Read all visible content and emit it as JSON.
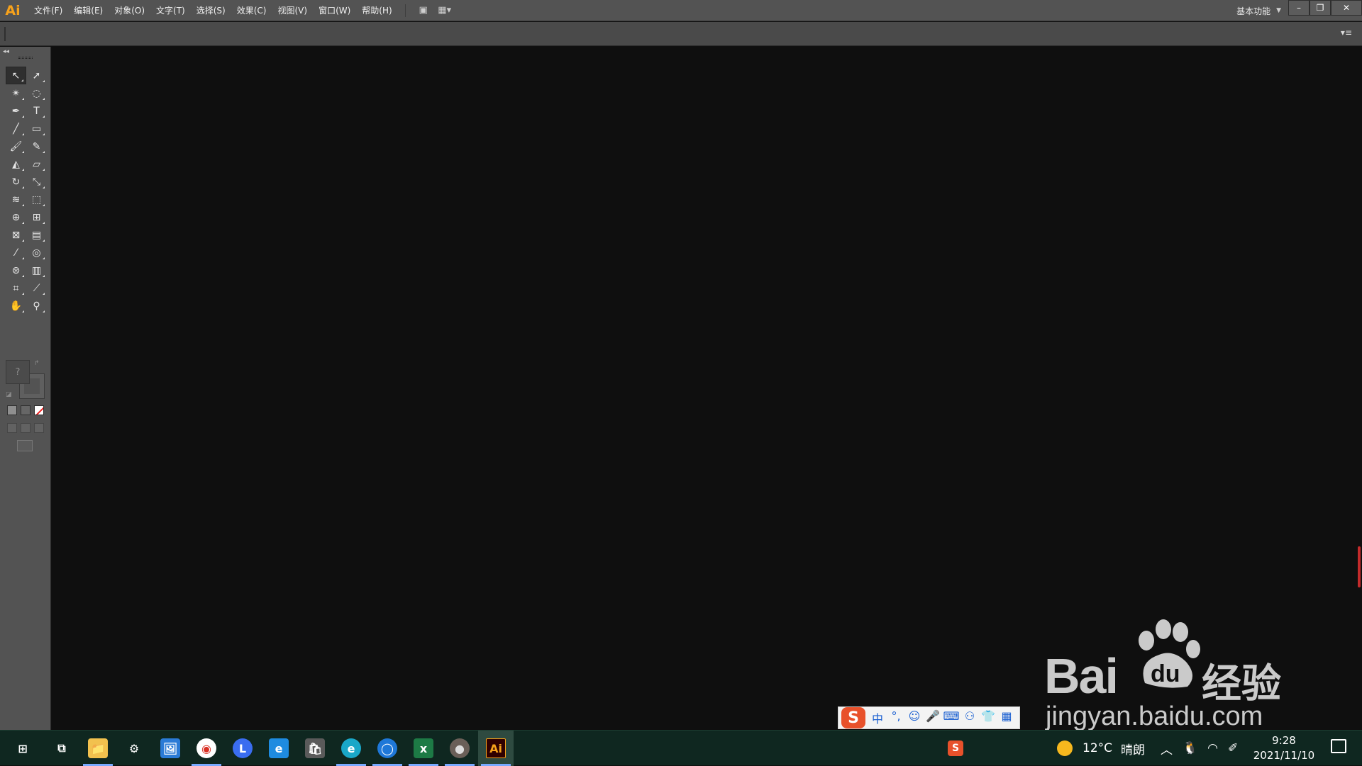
{
  "app": {
    "logo": "Ai",
    "menus": [
      "文件(F)",
      "编辑(E)",
      "对象(O)",
      "文字(T)",
      "选择(S)",
      "效果(C)",
      "视图(V)",
      "窗口(W)",
      "帮助(H)"
    ],
    "workspace": "基本功能",
    "window_controls": {
      "minimize": "–",
      "restore": "❐",
      "close": "✕"
    }
  },
  "tools": {
    "fill_placeholder": "?",
    "items": [
      {
        "name": "selection-tool",
        "glyph": "↖",
        "active": true
      },
      {
        "name": "direct-selection-tool",
        "glyph": "➚"
      },
      {
        "name": "magic-wand-tool",
        "glyph": "✴"
      },
      {
        "name": "lasso-tool",
        "glyph": "◌"
      },
      {
        "name": "pen-tool",
        "glyph": "✒"
      },
      {
        "name": "type-tool",
        "glyph": "T"
      },
      {
        "name": "line-segment-tool",
        "glyph": "╱"
      },
      {
        "name": "rectangle-tool",
        "glyph": "▭"
      },
      {
        "name": "paintbrush-tool",
        "glyph": "🖌"
      },
      {
        "name": "pencil-tool",
        "glyph": "✎"
      },
      {
        "name": "blob-brush-tool",
        "glyph": "◭"
      },
      {
        "name": "eraser-tool",
        "glyph": "▱"
      },
      {
        "name": "rotate-tool",
        "glyph": "↻"
      },
      {
        "name": "scale-tool",
        "glyph": "⤡"
      },
      {
        "name": "width-tool",
        "glyph": "≋"
      },
      {
        "name": "free-transform-tool",
        "glyph": "⬚"
      },
      {
        "name": "shape-builder-tool",
        "glyph": "⊕"
      },
      {
        "name": "perspective-grid-tool",
        "glyph": "⊞"
      },
      {
        "name": "mesh-tool",
        "glyph": "⊠"
      },
      {
        "name": "gradient-tool",
        "glyph": "▤"
      },
      {
        "name": "eyedropper-tool",
        "glyph": "⁄"
      },
      {
        "name": "blend-tool",
        "glyph": "◎"
      },
      {
        "name": "symbol-sprayer-tool",
        "glyph": "⊛"
      },
      {
        "name": "column-graph-tool",
        "glyph": "▥"
      },
      {
        "name": "artboard-tool",
        "glyph": "⌗"
      },
      {
        "name": "slice-tool",
        "glyph": "⟋"
      },
      {
        "name": "hand-tool",
        "glyph": "✋"
      },
      {
        "name": "zoom-tool",
        "glyph": "⚲"
      }
    ]
  },
  "ime": {
    "logo": "S",
    "items": [
      "中",
      "°,",
      "☺",
      "🎤",
      "⌨",
      "⚇",
      "👕",
      "▦"
    ]
  },
  "watermark": {
    "brand": "Bai",
    "brand_suffix": "du",
    "cn": "经验",
    "url": "jingyan.baidu.com"
  },
  "taskbar": {
    "apps": [
      {
        "name": "start-button",
        "glyph": "⊞"
      },
      {
        "name": "task-view-button",
        "glyph": "⧉"
      },
      {
        "name": "file-explorer",
        "glyph": "📁",
        "running": true
      },
      {
        "name": "settings",
        "glyph": "⚙"
      },
      {
        "name": "photos",
        "glyph": "🖼"
      },
      {
        "name": "chrome",
        "glyph": "◉",
        "running": true
      },
      {
        "name": "l-app",
        "glyph": "L"
      },
      {
        "name": "internet-explorer",
        "glyph": "e"
      },
      {
        "name": "store",
        "glyph": "🛍"
      },
      {
        "name": "edge-browser",
        "glyph": "e",
        "running": true
      },
      {
        "name": "chat-app",
        "glyph": "◯",
        "running": true
      },
      {
        "name": "excel",
        "glyph": "x",
        "running": true
      },
      {
        "name": "user-avatar-app",
        "glyph": "●",
        "running": true
      },
      {
        "name": "illustrator",
        "glyph": "Ai",
        "running": true,
        "active": true
      }
    ],
    "tray_ime": "S",
    "weather_temp": "12°C",
    "weather_text": "晴朗",
    "time": "9:28",
    "date": "2021/11/10"
  }
}
